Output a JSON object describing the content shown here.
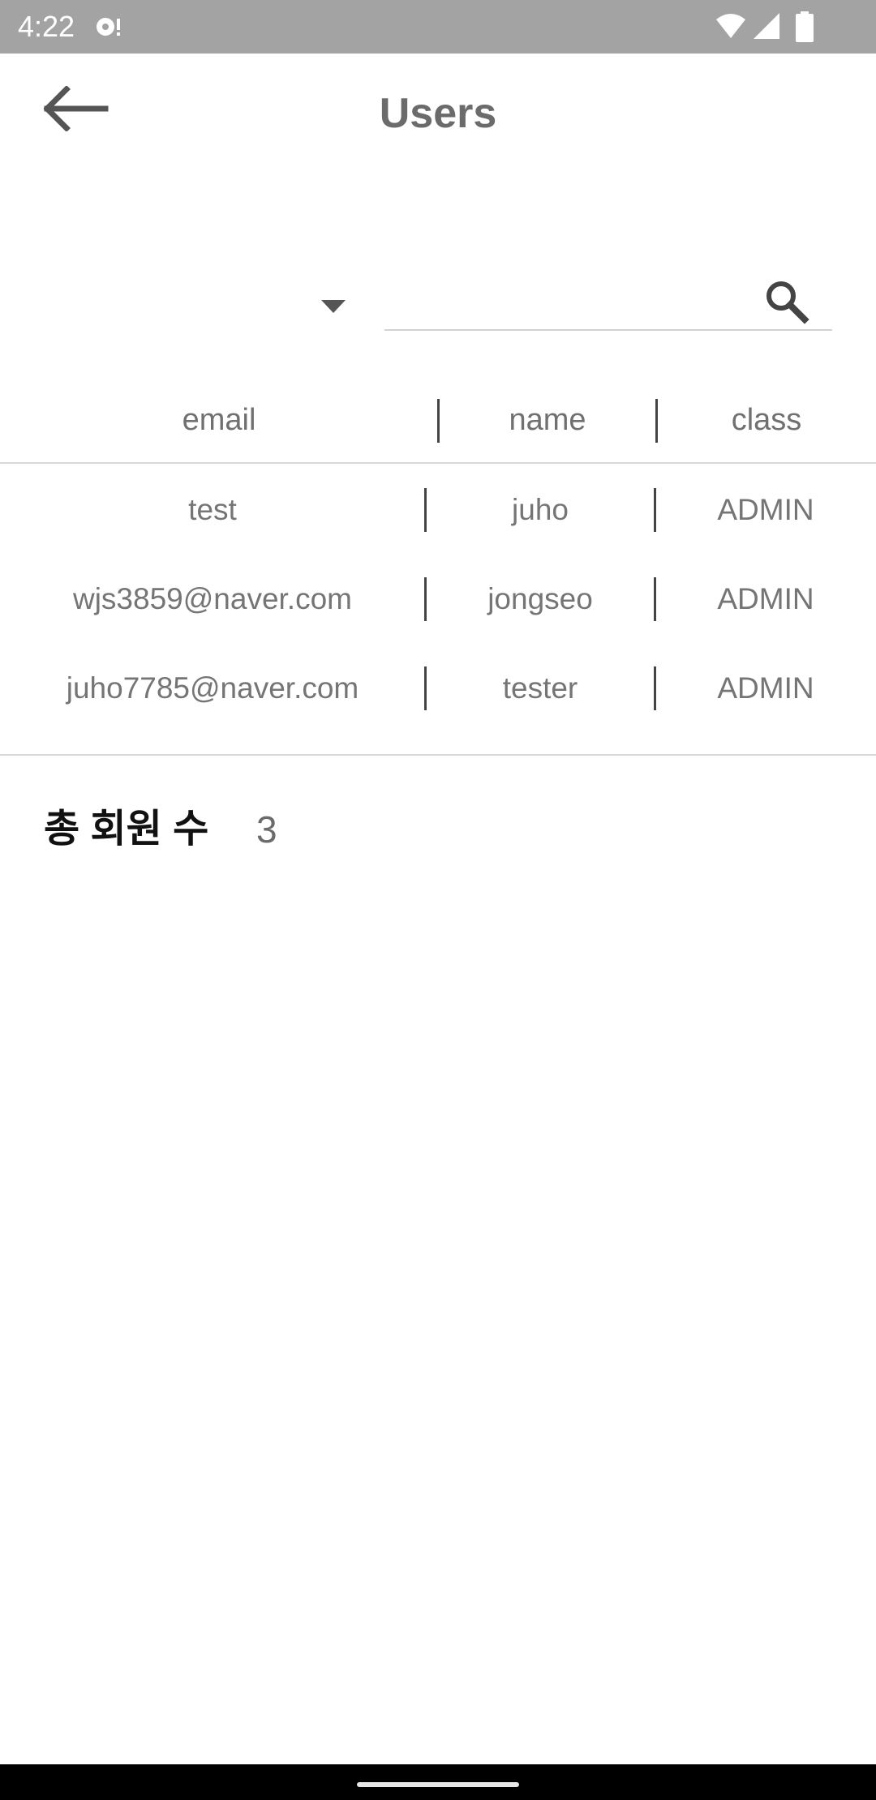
{
  "status_bar": {
    "time": "4:22",
    "icons": [
      "sync-icon",
      "wifi-icon",
      "signal-icon",
      "battery-icon"
    ]
  },
  "app_bar": {
    "title": "Users",
    "back_icon": "arrow-back-icon"
  },
  "filter": {
    "dropdown_value": "",
    "search_value": "",
    "search_placeholder": "",
    "search_icon": "search-icon"
  },
  "table": {
    "headers": [
      "email",
      "name",
      "class"
    ],
    "rows": [
      [
        "test",
        "juho",
        "ADMIN"
      ],
      [
        "wjs3859@naver.com",
        "jongseo",
        "ADMIN"
      ],
      [
        "juho7785@naver.com",
        "tester",
        "ADMIN"
      ]
    ]
  },
  "summary": {
    "label": "총 회원 수",
    "count": "3"
  },
  "colors": {
    "status_bar_bg": "#a3a3a3",
    "title_color": "#6b6b6b",
    "text_gray": "#757575"
  }
}
